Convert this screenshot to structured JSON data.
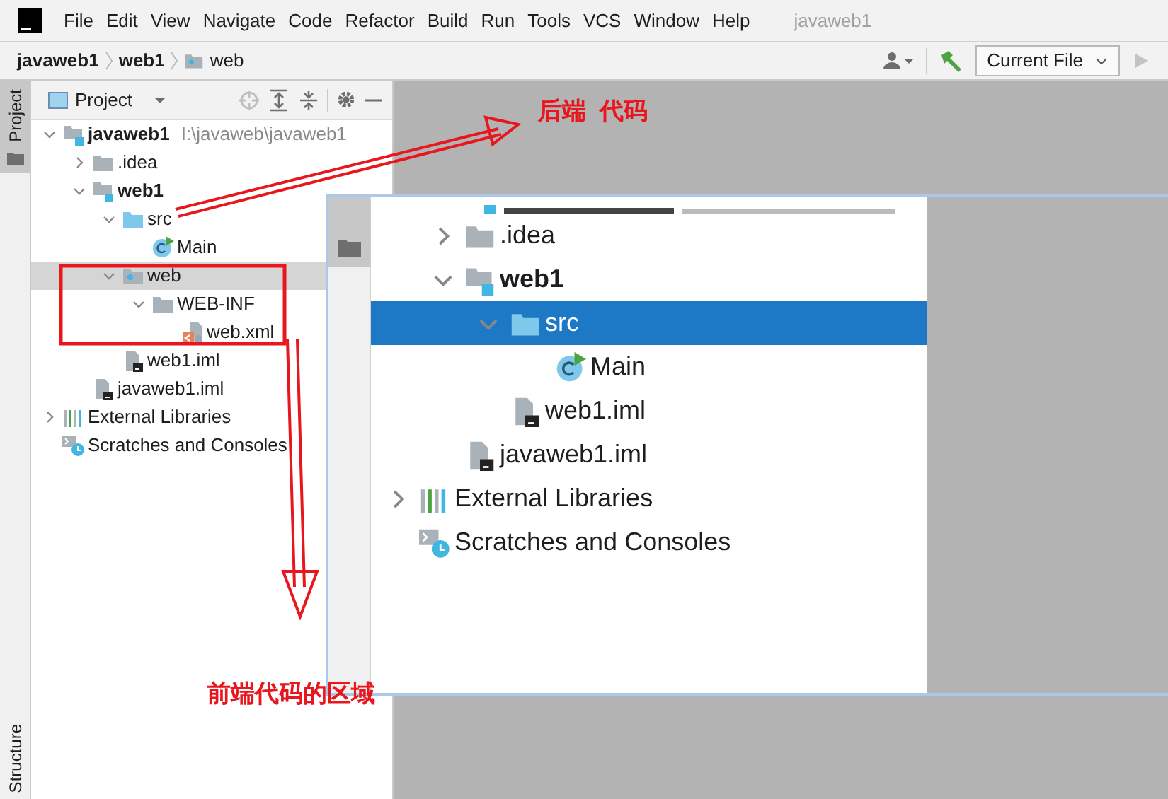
{
  "menu": {
    "items": [
      "File",
      "Edit",
      "View",
      "Navigate",
      "Code",
      "Refactor",
      "Build",
      "Run",
      "Tools",
      "VCS",
      "Window",
      "Help"
    ],
    "title": "javaweb1"
  },
  "breadcrumbs": [
    {
      "label": "javaweb1",
      "kind": "module"
    },
    {
      "label": "web1",
      "kind": "module"
    },
    {
      "label": "web",
      "kind": "web-folder"
    }
  ],
  "toolbar": {
    "run_config": "Current File",
    "run_disabled": true
  },
  "side_tabs": [
    {
      "label": "Project",
      "selected": true
    },
    {
      "label": "Structure",
      "selected": false
    }
  ],
  "project_panel": {
    "title": "Project",
    "tree": [
      {
        "label": "javaweb1",
        "kind": "module",
        "path": "I:\\javaweb\\javaweb1",
        "expanded": true,
        "selected": false,
        "children": [
          {
            "label": ".idea",
            "kind": "folder",
            "expanded": false,
            "selected": false
          },
          {
            "label": "web1",
            "kind": "module",
            "expanded": true,
            "selected": false,
            "children": [
              {
                "label": "src",
                "kind": "source-folder",
                "expanded": true,
                "selected": false,
                "children": [
                  {
                    "label": "Main",
                    "kind": "class",
                    "selected": false
                  }
                ]
              },
              {
                "label": "web",
                "kind": "web-folder",
                "expanded": true,
                "selected": true,
                "children": [
                  {
                    "label": "WEB-INF",
                    "kind": "folder",
                    "expanded": true,
                    "selected": false,
                    "children": [
                      {
                        "label": "web.xml",
                        "kind": "xml",
                        "selected": false
                      }
                    ]
                  }
                ]
              },
              {
                "label": "web1.iml",
                "kind": "iml",
                "selected": false
              }
            ]
          },
          {
            "label": "javaweb1.iml",
            "kind": "iml",
            "selected": false
          }
        ]
      },
      {
        "label": "External Libraries",
        "kind": "libraries",
        "expanded": false,
        "selected": false
      },
      {
        "label": "Scratches and Consoles",
        "kind": "scratches",
        "selected": false
      }
    ]
  },
  "inset": {
    "tree": [
      {
        "kind": "cut",
        "expanded": true,
        "children": [
          {
            "label": ".idea",
            "kind": "folder",
            "expanded": false,
            "selected": false
          },
          {
            "label": "web1",
            "kind": "module",
            "expanded": true,
            "selected": false,
            "children": [
              {
                "label": "src",
                "kind": "source-folder",
                "expanded": true,
                "selected": true,
                "children": [
                  {
                    "label": "Main",
                    "kind": "class",
                    "selected": false
                  }
                ]
              },
              {
                "label": "web1.iml",
                "kind": "iml",
                "selected": false
              }
            ]
          },
          {
            "label": "javaweb1.iml",
            "kind": "iml",
            "selected": false
          }
        ]
      },
      {
        "label": "External Libraries",
        "kind": "libraries",
        "expanded": false,
        "selected": false
      },
      {
        "label": "Scratches and Consoles",
        "kind": "scratches",
        "selected": false
      }
    ]
  },
  "annotations": [
    {
      "text": "后端  代码"
    },
    {
      "text": "前端代码的区域"
    }
  ]
}
